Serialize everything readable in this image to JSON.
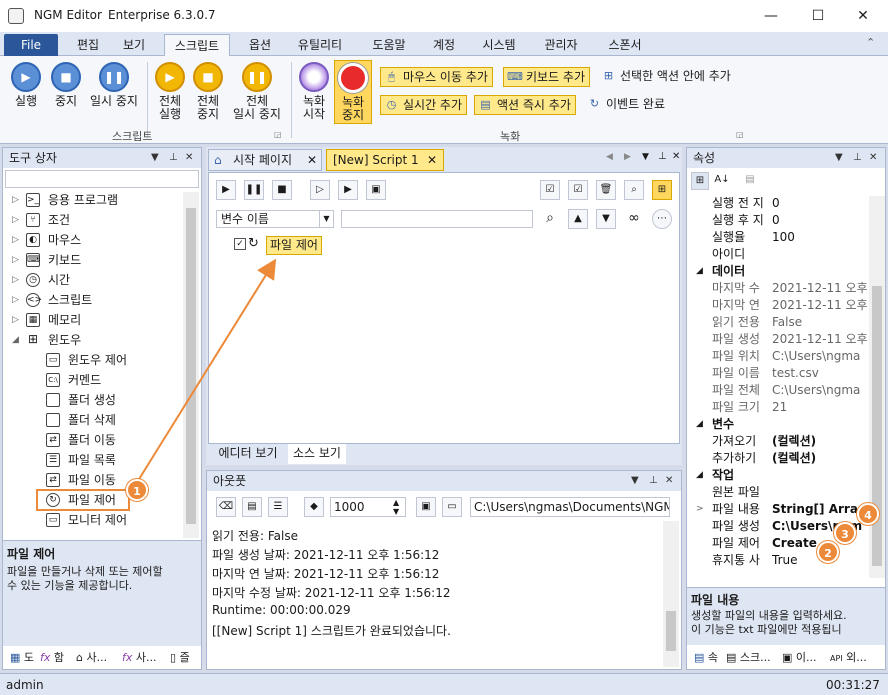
{
  "window": {
    "app_name": "NGM Editor",
    "edition": "Enterprise 6.3.0.7",
    "controls": {
      "minimize": "—",
      "maximize": "☐",
      "close": "✕"
    }
  },
  "menu": [
    "File",
    "편집",
    "보기",
    "스크립트",
    "옵션",
    "유틸리티",
    "도움말",
    "계정",
    "시스템",
    "관리자",
    "스폰서"
  ],
  "ribbon": {
    "run": "실행",
    "stop": "중지",
    "pause": "일시 중지",
    "run_all_1": "전체",
    "run_all_2": "실행",
    "stop_all_1": "전체",
    "stop_all_2": "중지",
    "pause_all_1": "전체",
    "pause_all_2": "일시 중지",
    "script_group": "스크립트",
    "record_start_1": "녹화",
    "record_start_2": "시작",
    "record_stop_1": "녹화",
    "record_stop_2": "중지",
    "add_mouse": "마우스 이동 추가",
    "add_keyboard": "키보드 추가",
    "add_in_selected": "선택한 액션 안에 추가",
    "add_realtime": "실시간 추가",
    "add_action_now": "액션 즉시 추가",
    "event_done": "이벤트 완료",
    "record_group": "녹화"
  },
  "toolbox": {
    "title": "도구 상자",
    "items": [
      {
        "label": "응용 프로그램",
        "icon": "console-icon"
      },
      {
        "label": "조건",
        "icon": "branch-icon"
      },
      {
        "label": "마우스",
        "icon": "mouse-icon"
      },
      {
        "label": "키보드",
        "icon": "keyboard-icon"
      },
      {
        "label": "시간",
        "icon": "clock-icon"
      },
      {
        "label": "스크립트",
        "icon": "script-icon"
      },
      {
        "label": "메모리",
        "icon": "memory-icon"
      },
      {
        "label": "윈도우",
        "icon": "windows-icon"
      }
    ],
    "children": [
      {
        "label": "윈도우 제어",
        "icon": "window-control-icon"
      },
      {
        "label": "커멘드",
        "icon": "command-icon"
      },
      {
        "label": "폴더 생성",
        "icon": "folder-icon"
      },
      {
        "label": "폴더 삭제",
        "icon": "folder-icon"
      },
      {
        "label": "폴더 이동",
        "icon": "folder-move-icon"
      },
      {
        "label": "파일 목록",
        "icon": "file-list-icon"
      },
      {
        "label": "파일 이동",
        "icon": "file-move-icon"
      },
      {
        "label": "파일 제어",
        "icon": "file-control-icon"
      },
      {
        "label": "모니터 제어",
        "icon": "monitor-icon"
      }
    ],
    "desc_title": "파일 제어",
    "desc_text_1": "파일을 만들거나 삭제 또는 제어할",
    "desc_text_2": "수 있는 기능을 제공합니다.",
    "bottom_tabs": [
      "도",
      "함",
      "사...",
      "사...",
      "즐"
    ]
  },
  "editor": {
    "tabs": [
      "시작 페이지",
      "[New] Script 1"
    ],
    "var_select": "변수 이름",
    "node_label": "파일 제어",
    "view_tabs": [
      "에디터 보기",
      "소스 보기"
    ]
  },
  "output": {
    "title": "아웃풋",
    "count": "1000",
    "path": "C:\\Users\\ngmas\\Documents\\NGM6\\",
    "lines": [
      "읽기 전용: False",
      "파일 생성 날짜: 2021-12-11 오후 1:56:12",
      "마지막 연 날짜: 2021-12-11 오후 1:56:12",
      "마지막 수정 날짜: 2021-12-11 오후 1:56:12",
      "Runtime: 00:00:00.029",
      "[[New] Script 1] 스크립트가 완료되었습니다."
    ]
  },
  "properties": {
    "title": "속성",
    "rows": [
      {
        "k": "실행 전 지",
        "v": "0",
        "type": "dark"
      },
      {
        "k": "실행 후 지",
        "v": "0",
        "type": "dark"
      },
      {
        "k": "실행율",
        "v": "100",
        "type": "dark"
      },
      {
        "k": "아이디",
        "v": "",
        "type": "dark"
      },
      {
        "k": "데이터",
        "v": "",
        "type": "cat"
      },
      {
        "k": "마지막 수",
        "v": "2021-12-11 오후 1",
        "type": "grey"
      },
      {
        "k": "마지막 연",
        "v": "2021-12-11 오후 1",
        "type": "grey"
      },
      {
        "k": "읽기 전용",
        "v": "False",
        "type": "grey"
      },
      {
        "k": "파일 생성",
        "v": "2021-12-11 오후 1",
        "type": "grey"
      },
      {
        "k": "파일 위치",
        "v": "C:\\Users\\ngma",
        "type": "grey"
      },
      {
        "k": "파일 이름",
        "v": "test.csv",
        "type": "grey"
      },
      {
        "k": "파일 전체",
        "v": "C:\\Users\\ngma",
        "type": "grey"
      },
      {
        "k": "파일 크기",
        "v": "21",
        "type": "grey"
      },
      {
        "k": "변수",
        "v": "",
        "type": "cat"
      },
      {
        "k": "가져오기",
        "v": "(컬렉션)",
        "type": "bold"
      },
      {
        "k": "추가하기",
        "v": "(컬렉션)",
        "type": "bold"
      },
      {
        "k": "작업",
        "v": "",
        "type": "cat"
      },
      {
        "k": "원본 파일",
        "v": "",
        "type": "dark"
      },
      {
        "k": "파일 내용",
        "v": "String[] Arra",
        "type": "bold"
      },
      {
        "k": "파일 생성",
        "v": "C:\\Users\\ngm",
        "type": "bold"
      },
      {
        "k": "파일 제어",
        "v": "Create",
        "type": "bold"
      },
      {
        "k": "휴지통 사",
        "v": "True",
        "type": "dark"
      }
    ],
    "desc_title": "파일 내용",
    "desc_text_1": "생성할 파일의 내용을 입력하세요.",
    "desc_text_2": "이 기능은 txt 파일에만 적용됩니",
    "bottom_tabs": [
      "속",
      "스크...",
      "이...",
      "외..."
    ]
  },
  "callouts": [
    "1",
    "2",
    "3",
    "4"
  ],
  "status": {
    "user": "admin",
    "time": "00:31:27"
  },
  "colors": {
    "accent": "#2b579a",
    "highlight": "#ffe98a",
    "callout": "#ec8a3a"
  }
}
